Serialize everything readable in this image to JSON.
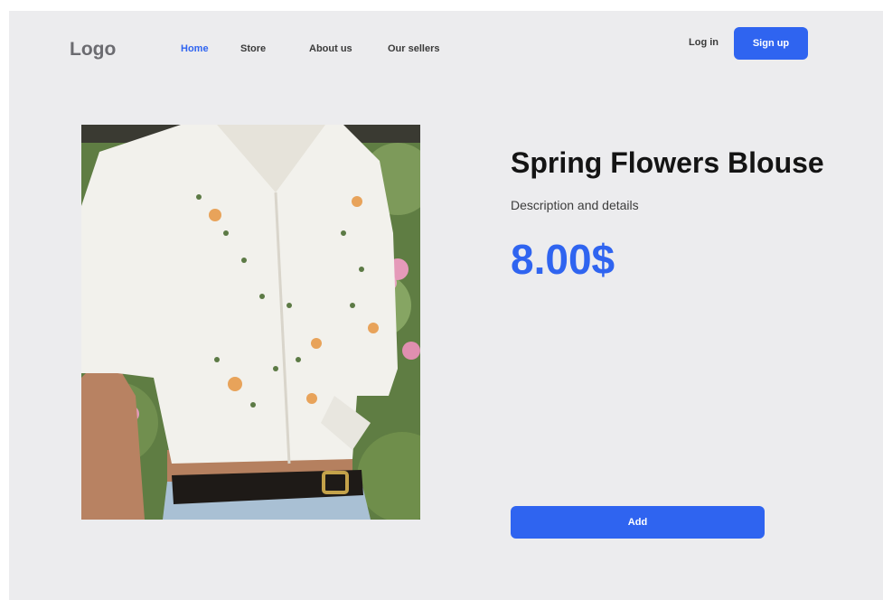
{
  "header": {
    "logo": "Logo",
    "nav": [
      {
        "label": "Home",
        "active": true
      },
      {
        "label": "Store",
        "active": false
      },
      {
        "label": "About us",
        "active": false
      },
      {
        "label": "Our sellers",
        "active": false
      }
    ],
    "login_label": "Log in",
    "signup_label": "Sign up"
  },
  "product": {
    "image_icon": "product-photo",
    "title": "Spring Flowers Blouse",
    "description": "Description and details",
    "price": "8.00$",
    "add_label": "Add"
  },
  "colors": {
    "accent": "#2f64f0",
    "background": "#ececee",
    "text": "#141414"
  }
}
